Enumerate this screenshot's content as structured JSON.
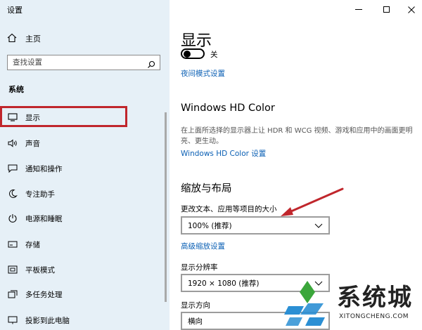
{
  "window": {
    "title": "设置"
  },
  "sidebar": {
    "home_label": "主页",
    "search_placeholder": "查找设置",
    "section_title": "系统",
    "items": [
      {
        "label": "显示",
        "icon": "monitor-icon"
      },
      {
        "label": "声音",
        "icon": "speaker-icon"
      },
      {
        "label": "通知和操作",
        "icon": "notification-icon"
      },
      {
        "label": "专注助手",
        "icon": "moon-icon"
      },
      {
        "label": "电源和睡眠",
        "icon": "power-icon"
      },
      {
        "label": "存储",
        "icon": "storage-icon"
      },
      {
        "label": "平板模式",
        "icon": "tablet-icon"
      },
      {
        "label": "多任务处理",
        "icon": "multitask-icon"
      },
      {
        "label": "投影到此电脑",
        "icon": "project-icon"
      }
    ],
    "active_index": 0,
    "highlight_color": "#c0262c"
  },
  "main": {
    "title": "显示",
    "night_light_state": "关",
    "night_light_link": "夜间模式设置",
    "hdr_title": "Windows HD Color",
    "hdr_desc": "在上面所选择的显示器上让 HDR 和 WCG 视频、游戏和应用中的画面更明亮、更生动。",
    "hdr_link": "Windows HD Color 设置",
    "scale_title": "缩放与布局",
    "scale_label": "更改文本、应用等项目的大小",
    "scale_value": "100% (推荐)",
    "advanced_link": "高级缩放设置",
    "resolution_label": "显示分辨率",
    "resolution_value": "1920 × 1080 (推荐)",
    "orientation_label": "显示方向",
    "orientation_value": "横向",
    "link_color": "#0a5fb4"
  },
  "watermark": {
    "text": "系统城",
    "url": "XITONGCHENG.COM"
  }
}
